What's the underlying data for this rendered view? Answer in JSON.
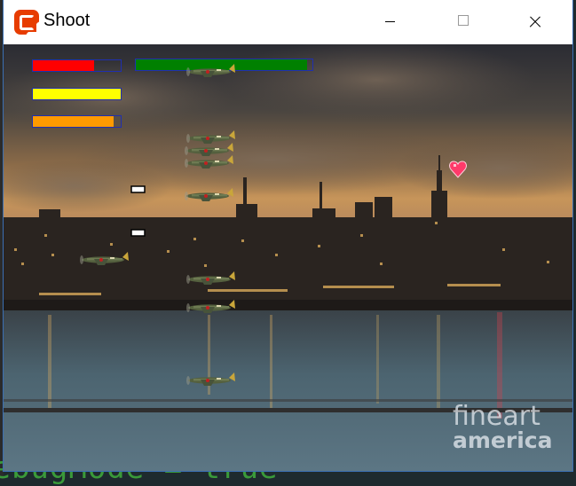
{
  "window": {
    "title": "Shoot"
  },
  "editor_remnant": {
    "text": "DebugMode = true"
  },
  "hud": {
    "health": {
      "fraction": 0.7,
      "color": "#ff0000"
    },
    "ammo": {
      "fraction": 1.0,
      "color": "#ffff00"
    },
    "fuel": {
      "fraction": 0.92,
      "color": "#ff9a00"
    },
    "boss": {
      "fraction": 0.97,
      "color": "#008000"
    },
    "frame_color": "#1f2fb0"
  },
  "sprites": {
    "enemy_plane_count": 9,
    "enemy_plane_icon": "fighter-plane-icon",
    "pickup_icon": "heart-icon",
    "bullet_icon": "bullet-icon"
  },
  "background": {
    "scene": "city-skyline-at-dusk"
  },
  "watermark": {
    "line1": "fineart",
    "line2": "america"
  }
}
